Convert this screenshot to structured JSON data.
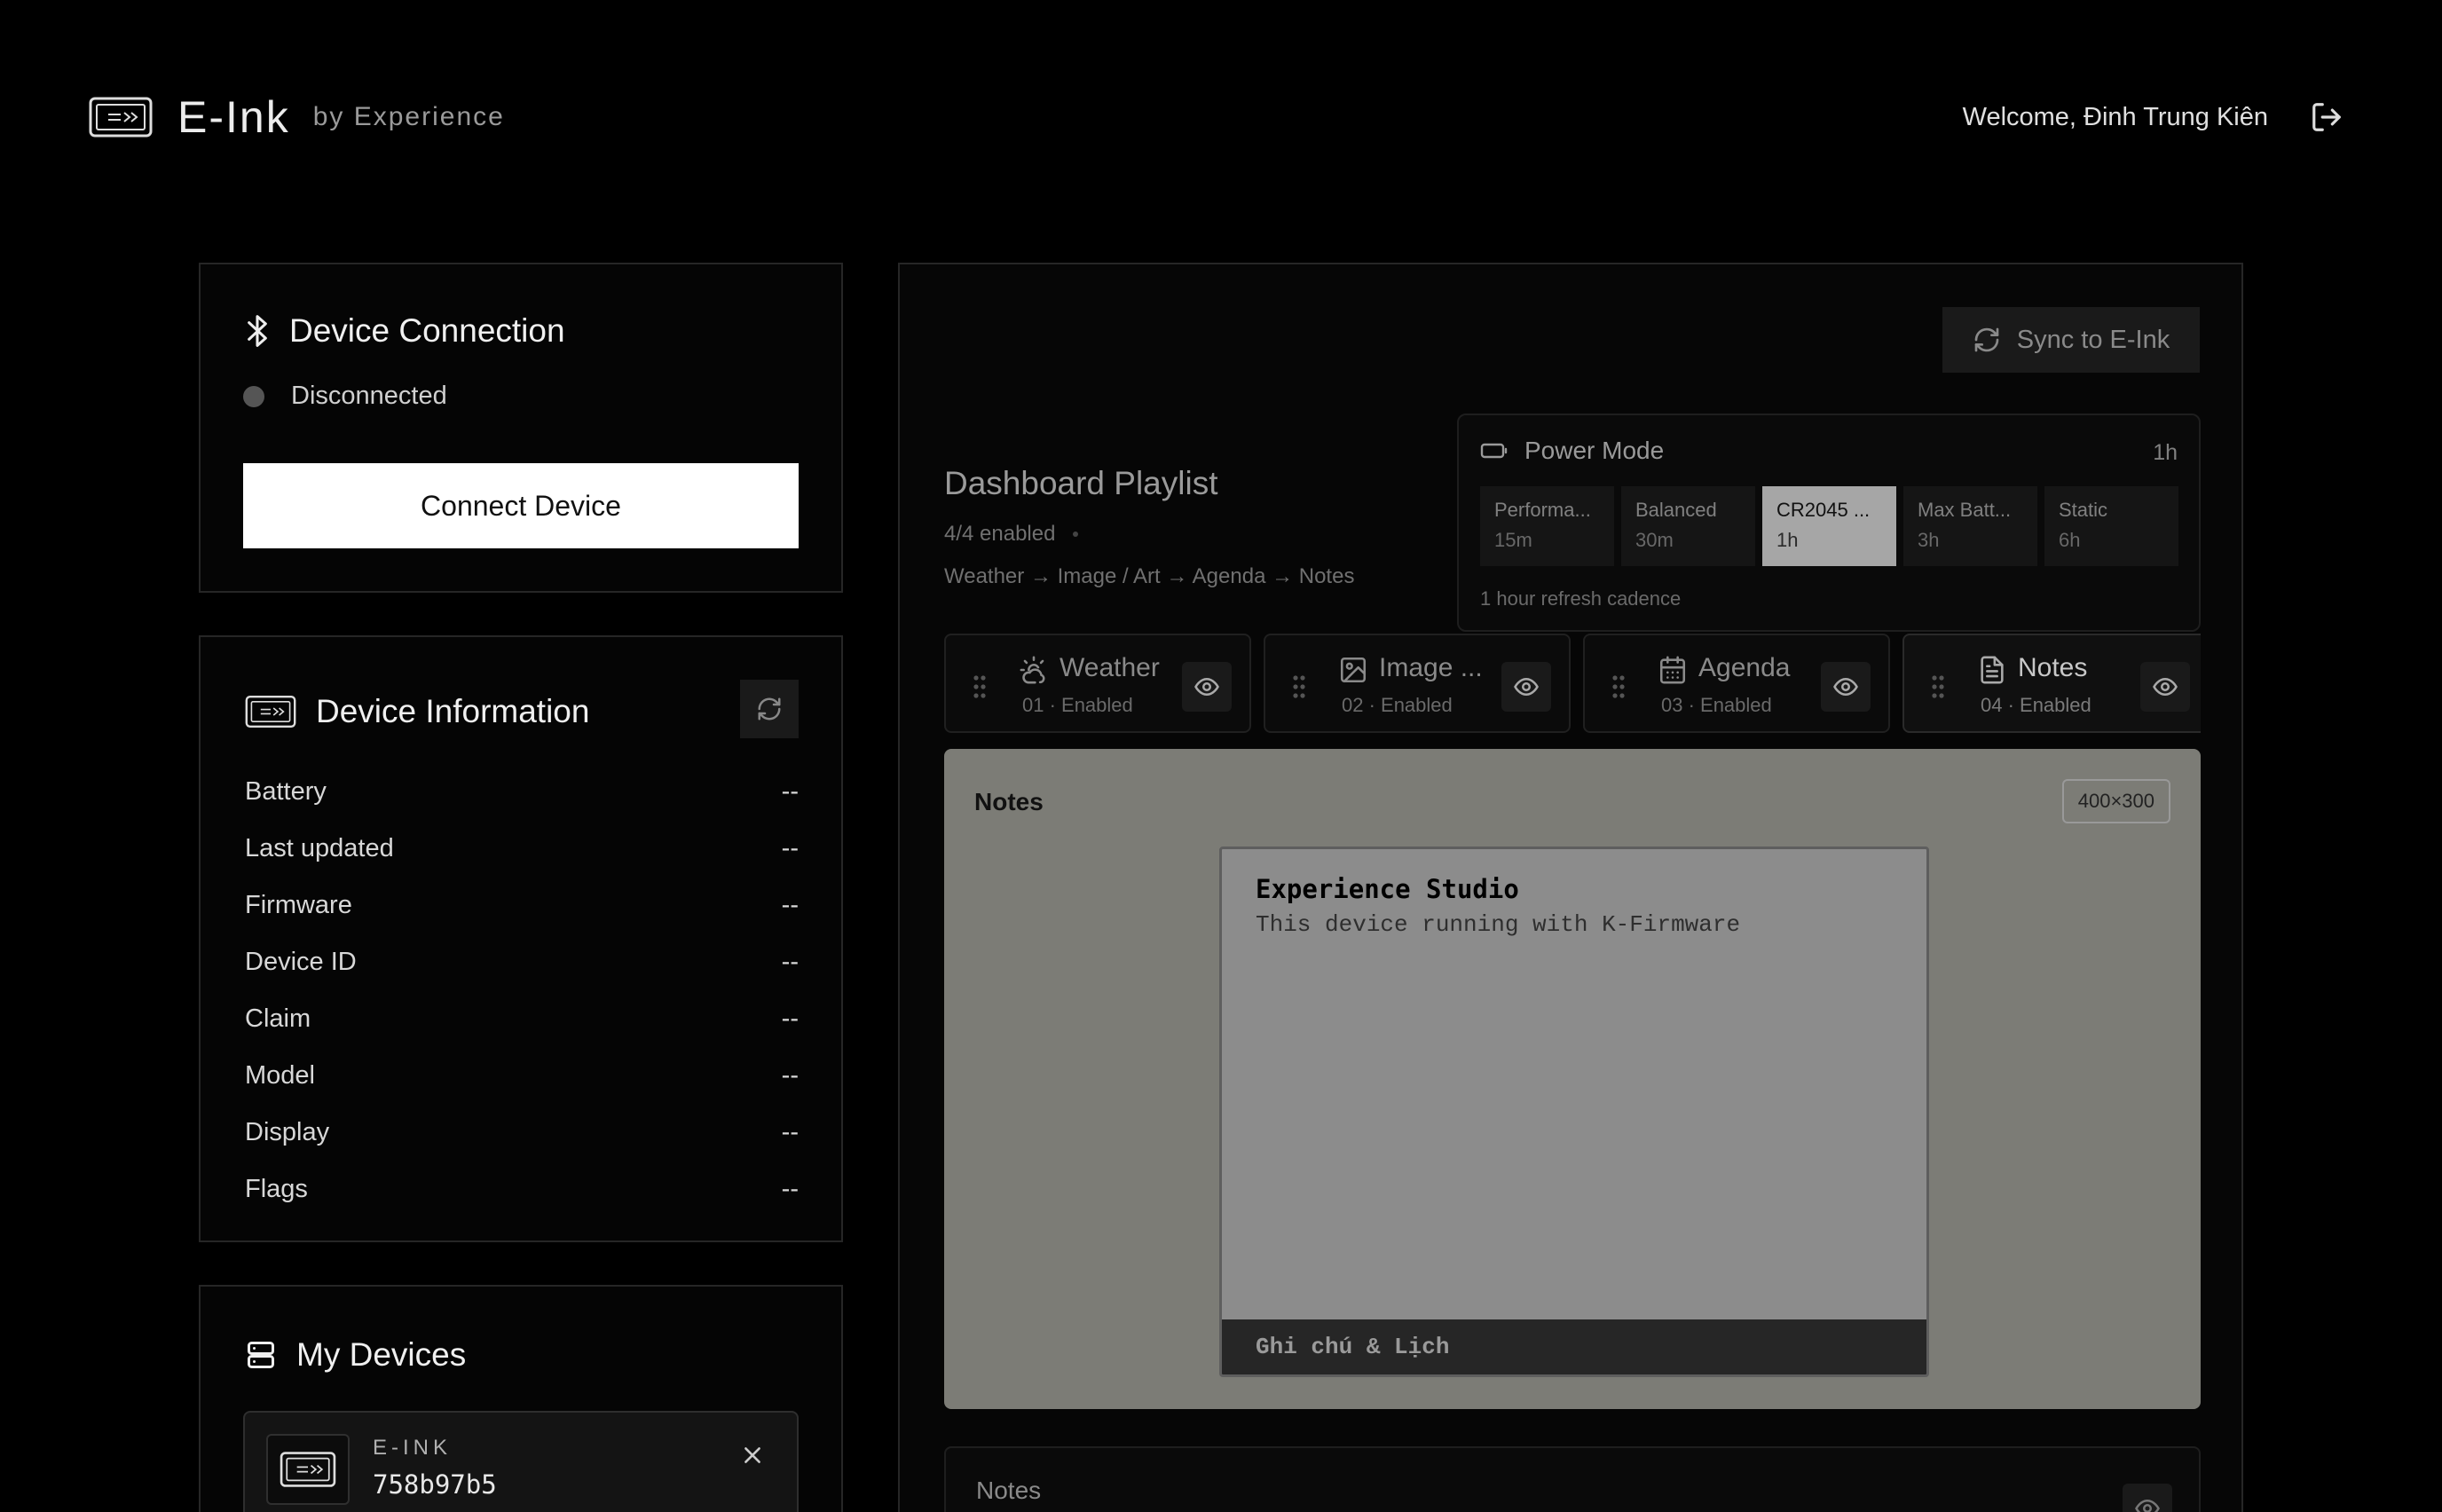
{
  "header": {
    "brand_title": "E-Ink",
    "brand_subtitle": "by Experience",
    "welcome": "Welcome, Đinh Trung Kiên",
    "logo_icon": "eink-device-icon",
    "logout_icon": "logout-icon"
  },
  "connection": {
    "title": "Device Connection",
    "icon": "bluetooth-icon",
    "status": "Disconnected",
    "connect_label": "Connect Device"
  },
  "info": {
    "title": "Device Information",
    "icon": "eink-device-icon",
    "refresh_icon": "refresh-icon",
    "rows": [
      {
        "label": "Battery",
        "value": "--"
      },
      {
        "label": "Last updated",
        "value": "--"
      },
      {
        "label": "Firmware",
        "value": "--"
      },
      {
        "label": "Device ID",
        "value": "--"
      },
      {
        "label": "Claim",
        "value": "--"
      },
      {
        "label": "Model",
        "value": "--"
      },
      {
        "label": "Display",
        "value": "--"
      },
      {
        "label": "Flags",
        "value": "--"
      }
    ]
  },
  "devices": {
    "title": "My Devices",
    "icon": "server-icon",
    "items": [
      {
        "kind": "E-INK",
        "id": "758b97b5"
      }
    ]
  },
  "main": {
    "sync_label": "Sync to E-Ink",
    "playlist_title": "Dashboard Playlist",
    "playlist_enabled": "4/4 enabled",
    "playlist_order": "Weather → Image / Art → Agenda → Notes",
    "power": {
      "title": "Power Mode",
      "current": "1h",
      "options": [
        {
          "name": "Performa...",
          "time": "15m",
          "active": false
        },
        {
          "name": "Balanced",
          "time": "30m",
          "active": false
        },
        {
          "name": "CR2045 ...",
          "time": "1h",
          "active": true
        },
        {
          "name": "Max Batt...",
          "time": "3h",
          "active": false
        },
        {
          "name": "Static",
          "time": "6h",
          "active": false
        }
      ],
      "note": "1 hour refresh cadence"
    },
    "widgets": [
      {
        "name": "Weather",
        "sub": "01 · Enabled",
        "icon": "weather-icon"
      },
      {
        "name": "Image ...",
        "sub": "02 · Enabled",
        "icon": "image-icon"
      },
      {
        "name": "Agenda",
        "sub": "03 · Enabled",
        "icon": "calendar-icon"
      },
      {
        "name": "Notes",
        "sub": "04 · Enabled",
        "icon": "notes-icon"
      }
    ],
    "preview": {
      "title": "Notes",
      "resolution": "400×300",
      "screen_heading": "Experience Studio",
      "screen_line": "This device running with K-Firmware",
      "screen_footer": "Ghi chú & Lịch"
    },
    "notes_editor_title": "Notes"
  }
}
